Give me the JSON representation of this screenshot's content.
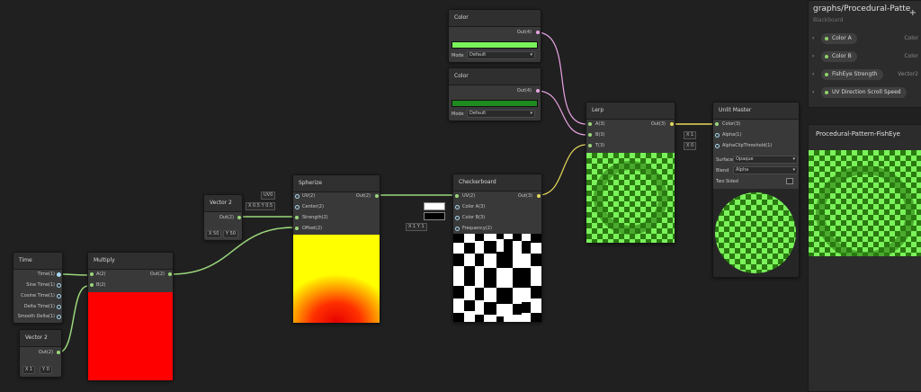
{
  "nodes": {
    "time": {
      "title": "Time",
      "outputs": [
        "Time(1)",
        "Sine Time(1)",
        "Cosine Time(1)",
        "Delta Time(1)",
        "Smooth Delta(1)"
      ]
    },
    "vector2_bottom": {
      "title": "Vector 2",
      "output": "Out(2)",
      "x_label": "X",
      "x_value": "1",
      "y_label": "Y",
      "y_value": "0"
    },
    "multiply": {
      "title": "Multiply",
      "inputs": [
        "A(2)",
        "B(2)"
      ],
      "output": "Out(2)"
    },
    "vector2_top": {
      "title": "Vector 2",
      "output": "Out(2)",
      "x_label": "X",
      "x_value": "50",
      "y_label": "Y",
      "y_value": "50"
    },
    "spherize": {
      "title": "Spherize",
      "inputs": [
        "UV(2)",
        "Center(2)",
        "Strength(2)",
        "Offset(2)"
      ],
      "output": "Out(2)",
      "uv_value": "UV0",
      "center_x": "X 0.5",
      "center_y": "Y 0.5"
    },
    "checkerboard": {
      "title": "Checkerboard",
      "inputs": [
        "UV(2)",
        "Color A(3)",
        "Color B(3)",
        "Frequency(2)"
      ],
      "output": "Out(3)",
      "freq_x": "X 1",
      "freq_y": "Y 1"
    },
    "color_a": {
      "title": "Color",
      "output": "Out(4)",
      "mode_label": "Mode",
      "mode_value": "Default",
      "swatch": "#7af25a"
    },
    "color_b": {
      "title": "Color",
      "output": "Out(4)",
      "mode_label": "Mode",
      "mode_value": "Default",
      "swatch": "#1f8a1f"
    },
    "lerp": {
      "title": "Lerp",
      "inputs": [
        "A(3)",
        "B(3)",
        "T(3)"
      ],
      "output": "Out(3)"
    },
    "unlit_master": {
      "title": "Unlit Master",
      "inputs": [
        "Color(3)",
        "Alpha(1)",
        "AlphaClipThreshold(1)"
      ],
      "alpha_value": "X 1",
      "clip_value": "X 0",
      "surface_label": "Surface",
      "surface_value": "Opaque",
      "blend_label": "Blend",
      "blend_value": "Alpha",
      "two_sided_label": "Two Sided"
    }
  },
  "blackboard": {
    "title": "graphs/Procedural-Patte",
    "subtitle": "Blackboard",
    "add_label": "+",
    "properties": [
      {
        "name": "Color A",
        "type": "Color"
      },
      {
        "name": "Color B",
        "type": "Color"
      },
      {
        "name": "FishEye Strength",
        "type": "Vector2"
      },
      {
        "name": "UV Direction Scroll Speed",
        "type": ""
      }
    ]
  },
  "main_preview": {
    "title": "Procedural-Pattern-FishEye"
  },
  "colors": {
    "accent_green": "#7af25a",
    "dark_green": "#1f7a14",
    "wire_green": "#9bd77a",
    "wire_pink": "#e9a3e5",
    "wire_yellow": "#e6d85c",
    "background": "#202020"
  }
}
